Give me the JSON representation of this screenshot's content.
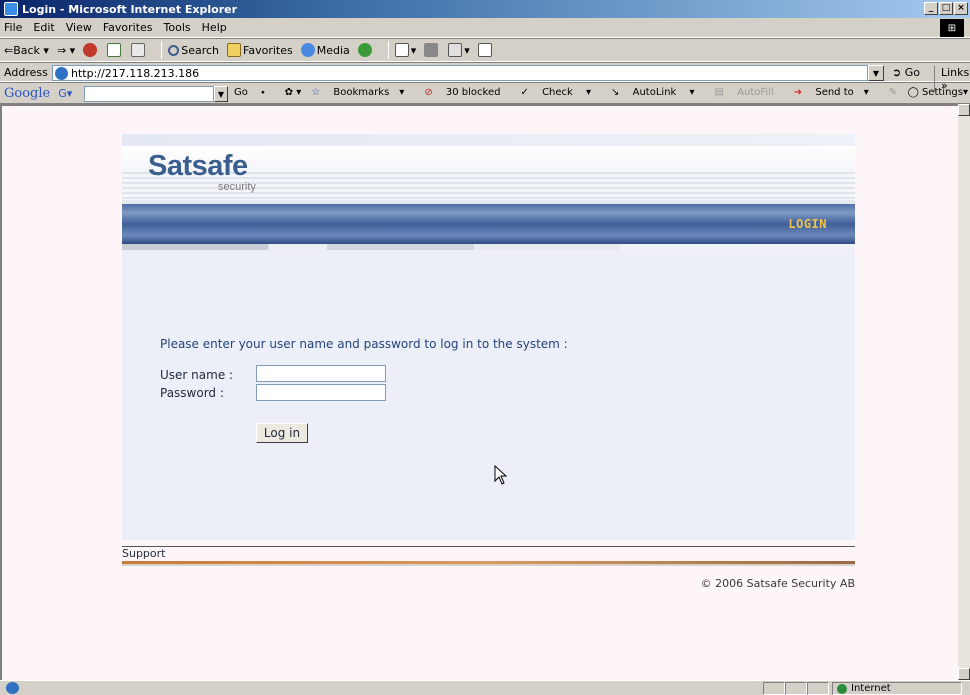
{
  "window": {
    "title": "Login - Microsoft Internet Explorer",
    "min_glyph": "_",
    "max_glyph": "□",
    "close_glyph": "×"
  },
  "menu": {
    "items": [
      "File",
      "Edit",
      "View",
      "Favorites",
      "Tools",
      "Help"
    ]
  },
  "toolbar": {
    "back": "Back",
    "search": "Search",
    "favorites": "Favorites",
    "media": "Media"
  },
  "address": {
    "label": "Address",
    "url": "http://217.118.213.186",
    "go": "Go",
    "links": "Links"
  },
  "google": {
    "logo_g": "Google",
    "go": "Go",
    "bookmarks": "Bookmarks",
    "blocked": "30 blocked",
    "check": "Check",
    "autolink": "AutoLink",
    "autofill": "AutoFill",
    "sendto": "Send to",
    "settings": "Settings"
  },
  "page": {
    "brand": "Satsafe",
    "brand_sub": "security",
    "nav_login": "LOGIN",
    "prompt": "Please enter your user name and password to log in to the system :",
    "username_label": "User name :",
    "password_label": "Password :",
    "username_value": "",
    "password_value": "",
    "login_button": "Log in",
    "support": "Support",
    "copyright": "© 2006 Satsafe Security AB"
  },
  "status": {
    "zone": "Internet"
  }
}
